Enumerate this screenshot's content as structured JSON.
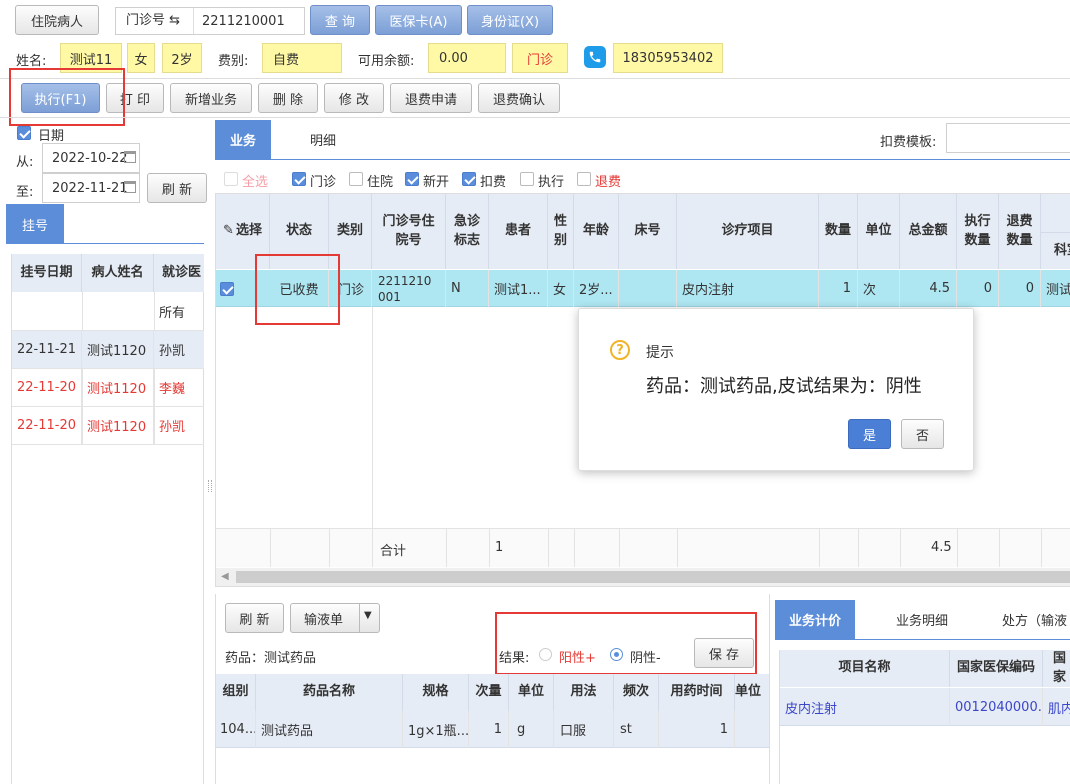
{
  "top": {
    "inpatient_btn": "住院病人",
    "clinic_no_label": "门诊号 ⇆",
    "clinic_no_value": "2211210001",
    "query_btn": "查 询",
    "insurance_card_btn": "医保卡(A)",
    "id_card_btn": "身份证(X)"
  },
  "patient": {
    "name_label": "姓名:",
    "name": "测试11",
    "gender": "女",
    "age": "2岁",
    "fee_label": "费别:",
    "fee_type": "自费",
    "balance_label": "可用余额:",
    "balance": "0.00",
    "visit_type": "门诊",
    "phone": "18305953402"
  },
  "toolbar": {
    "execute": "执行(F1)",
    "print": "打 印",
    "add_business": "新增业务",
    "delete": "删 除",
    "modify": "修 改",
    "refund_apply": "退费申请",
    "refund_confirm": "退费确认"
  },
  "left": {
    "date_label": "日期",
    "from_label": "从:",
    "from_date": "2022-10-22",
    "to_label": "至:",
    "to_date": "2022-11-21",
    "refresh": "刷 新",
    "tab": "挂号",
    "headers": [
      "挂号日期",
      "病人姓名",
      "就诊医"
    ],
    "filter_row": "所有",
    "rows": [
      {
        "date": "22-11-21",
        "name": "测试1120",
        "doctor": "孙凯",
        "red": false
      },
      {
        "date": "22-11-20",
        "name": "测试1120",
        "doctor": "李巍",
        "red": true
      },
      {
        "date": "22-11-20",
        "name": "测试1120",
        "doctor": "孙凯",
        "red": true
      }
    ]
  },
  "main": {
    "tab_business": "业务",
    "tab_detail": "明细",
    "deduct_template_label": "扣费模板:",
    "filters": {
      "all": "全选",
      "clinic": "门诊",
      "inpatient": "住院",
      "new": "新开",
      "deduct": "扣费",
      "execute": "执行",
      "refund": "退费"
    },
    "headers": {
      "select": "选择",
      "status": "状态",
      "category": "类别",
      "clinic_no": "门诊号住院号",
      "emergency": "急诊标志",
      "patient": "患者",
      "gender": "性别",
      "age": "年龄",
      "bed": "床号",
      "item": "诊疗项目",
      "qty": "数量",
      "unit": "单位",
      "total": "总金额",
      "exec_qty": "执行数量",
      "refund_qty": "退费数量",
      "dept": "科室"
    },
    "row": {
      "status": "已收费",
      "category": "门诊",
      "clinic_no": "2211210001",
      "emergency": "N",
      "patient": "测试1...",
      "gender": "女",
      "age": "2岁...",
      "bed": "",
      "item": "皮内注射",
      "qty": "1",
      "unit": "次",
      "total": "4.5",
      "exec_qty": "0",
      "refund_qty": "0",
      "dept": "测试"
    },
    "summary_label": "合计",
    "summary_count": "1",
    "summary_total": "4.5"
  },
  "dialog": {
    "title": "提示",
    "message": "药品：测试药品,皮试结果为：阴性",
    "yes": "是",
    "no": "否"
  },
  "bottom_left": {
    "refresh": "刷 新",
    "infusion": "输液单",
    "drug_label": "药品：测试药品",
    "result_label": "结果:",
    "positive": "阳性+",
    "negative": "阴性-",
    "save": "保 存",
    "headers": [
      "组别",
      "药品名称",
      "规格",
      "次量",
      "单位",
      "用法",
      "频次",
      "用药时间",
      "单位"
    ],
    "row": [
      "104...",
      "测试药品",
      "1g×1瓶...",
      "1",
      "g",
      "口服",
      "st",
      "1",
      ""
    ]
  },
  "bottom_right": {
    "tab_pricing": "业务计价",
    "tab_detail": "业务明细",
    "tab_prescription": "处方（输液",
    "headers": [
      "项目名称",
      "国家医保编码",
      "国家"
    ],
    "row": [
      "皮内注射",
      "0012040000...",
      "肌内"
    ]
  },
  "colors": {
    "accent": "#5b8dd9",
    "highlight_row": "#aee6f2",
    "red_annotation": "#e53935",
    "yellow_field": "#fff9a6"
  }
}
